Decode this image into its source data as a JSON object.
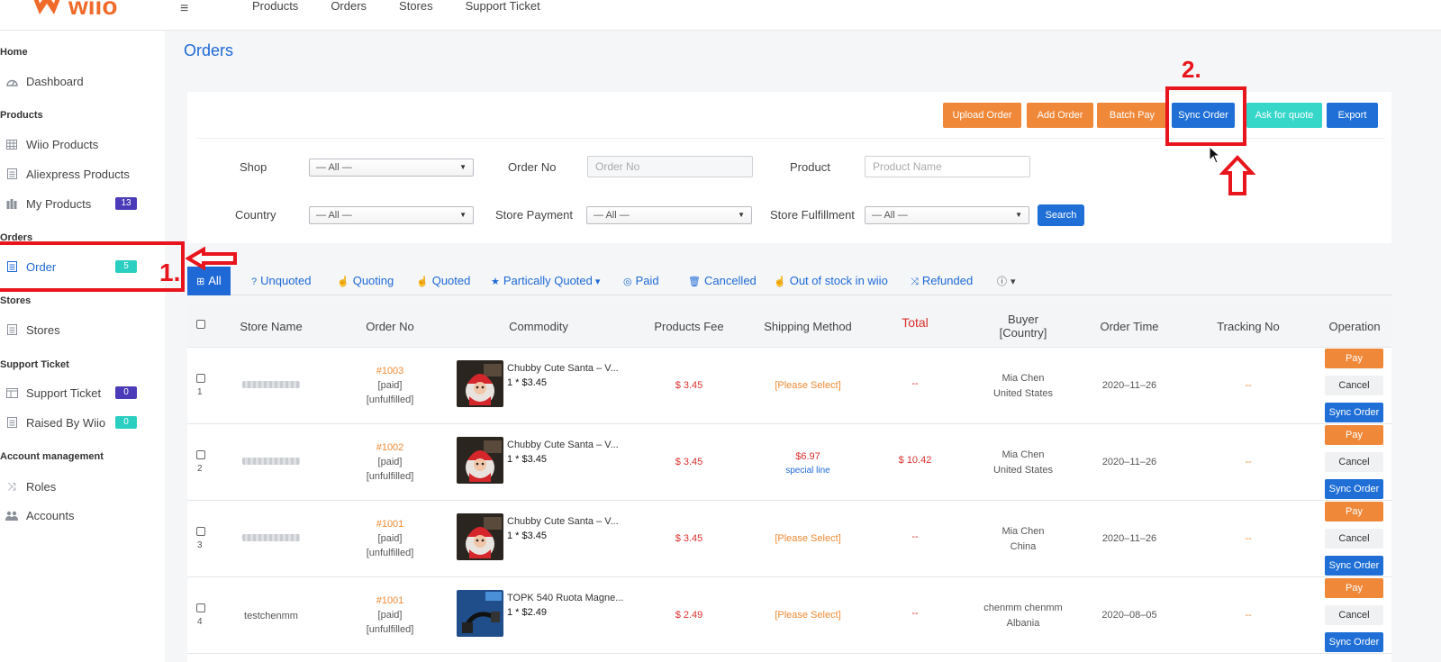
{
  "brand": {
    "logo_text": "wiio",
    "accent": "#1f69d6",
    "logo_color": "#f06a2a"
  },
  "topnav": [
    "Products",
    "Orders",
    "Stores",
    "Support Ticket"
  ],
  "sidebar": {
    "sections": {
      "home": "Home",
      "products": "Products",
      "orders": "Orders",
      "stores": "Stores",
      "support": "Support Ticket",
      "account": "Account management"
    },
    "items": {
      "dashboard": {
        "label": "Dashboard",
        "icon": "dashboard-icon"
      },
      "wiio_products": {
        "label": "Wiio Products",
        "icon": "grid-icon"
      },
      "aliexpress_products": {
        "label": "Aliexpress Products",
        "icon": "list-icon"
      },
      "my_products": {
        "label": "My Products",
        "icon": "bars-icon",
        "badge": "13"
      },
      "order": {
        "label": "Order",
        "icon": "order-icon",
        "badge": "5"
      },
      "stores": {
        "label": "Stores",
        "icon": "list-icon"
      },
      "support_ticket": {
        "label": "Support Ticket",
        "icon": "columns-icon",
        "badge": "0"
      },
      "raised_by_wiio": {
        "label": "Raised By Wiio",
        "icon": "list-icon",
        "badge": "0"
      },
      "roles": {
        "label": "Roles",
        "icon": "shuffle-icon"
      },
      "accounts": {
        "label": "Accounts",
        "icon": "users-icon"
      }
    }
  },
  "page": {
    "title": "Orders"
  },
  "actions": {
    "upload_order": "Upload Order",
    "add_order": "Add Order",
    "batch_pay": "Batch Pay",
    "sync_order": "Sync Order",
    "ask_for_quote": "Ask for quote",
    "export": "Export"
  },
  "filters": {
    "shop_label": "Shop",
    "shop_value": "— All —",
    "order_no_label": "Order No",
    "order_no_placeholder": "Order No",
    "product_label": "Product",
    "product_placeholder": "Product Name",
    "country_label": "Country",
    "country_value": "— All —",
    "store_payment_label": "Store Payment",
    "store_payment_value": "— All —",
    "store_fulfillment_label": "Store Fulfillment",
    "store_fulfillment_value": "— All —",
    "search_label": "Search"
  },
  "tabs": {
    "all": "All",
    "unquoted": "Unquoted",
    "quoting": "Quoting",
    "quoted": "Quoted",
    "partially_quoted": "Partically Quoted",
    "paid": "Paid",
    "cancelled": "Cancelled",
    "out_of_stock": "Out of stock in wiio",
    "refunded": "Refunded"
  },
  "table": {
    "headers": {
      "store_name": "Store Name",
      "order_no": "Order No",
      "commodity": "Commodity",
      "products_fee": "Products Fee",
      "shipping_method": "Shipping Method",
      "total": "Total",
      "buyer": "Buyer",
      "buyer_sub": "[Country]",
      "order_time": "Order Time",
      "tracking_no": "Tracking No",
      "operation": "Operation"
    },
    "rows": [
      {
        "index": "1",
        "store": "",
        "order_no": "#1003",
        "paid": "[paid]",
        "fulfill": "[unfulfilled]",
        "product": "Chubby Cute Santa – V...",
        "qty": "1 * $3.45",
        "fee": "$ 3.45",
        "ship": "[Please Select]",
        "ship_sub": "",
        "total": "--",
        "buyer": "Mia Chen",
        "country": "United States",
        "time": "2020–11–26",
        "tracking": "--",
        "thumb": "santa"
      },
      {
        "index": "2",
        "store": "",
        "order_no": "#1002",
        "paid": "[paid]",
        "fulfill": "[unfulfilled]",
        "product": "Chubby Cute Santa – V...",
        "qty": "1 * $3.45",
        "fee": "$ 3.45",
        "ship": "$6.97",
        "ship_sub": "special line",
        "total": "$ 10.42",
        "buyer": "Mia Chen",
        "country": "United States",
        "time": "2020–11–26",
        "tracking": "--",
        "thumb": "santa"
      },
      {
        "index": "3",
        "store": "",
        "order_no": "#1001",
        "paid": "[paid]",
        "fulfill": "[unfulfilled]",
        "product": "Chubby Cute Santa – V...",
        "qty": "1 * $3.45",
        "fee": "$ 3.45",
        "ship": "[Please Select]",
        "ship_sub": "",
        "total": "--",
        "buyer": "Mia Chen",
        "country": "China",
        "time": "2020–11–26",
        "tracking": "--",
        "thumb": "santa"
      },
      {
        "index": "4",
        "store": "testchenmm",
        "order_no": "#1001",
        "paid": "[paid]",
        "fulfill": "[unfulfilled]",
        "product": "TOPK 540 Ruota Magne...",
        "qty": "1 * $2.49",
        "fee": "$ 2.49",
        "ship": "[Please Select]",
        "ship_sub": "",
        "total": "--",
        "buyer": "chenmm chenmm",
        "country": "Albania",
        "time": "2020–08–05",
        "tracking": "--",
        "thumb": "cable"
      }
    ],
    "op_labels": {
      "pay": "Pay",
      "cancel": "Cancel",
      "sync": "Sync Order"
    }
  },
  "annotations": {
    "step1": "1.",
    "step2": "2.",
    "color": "#e8151c"
  }
}
